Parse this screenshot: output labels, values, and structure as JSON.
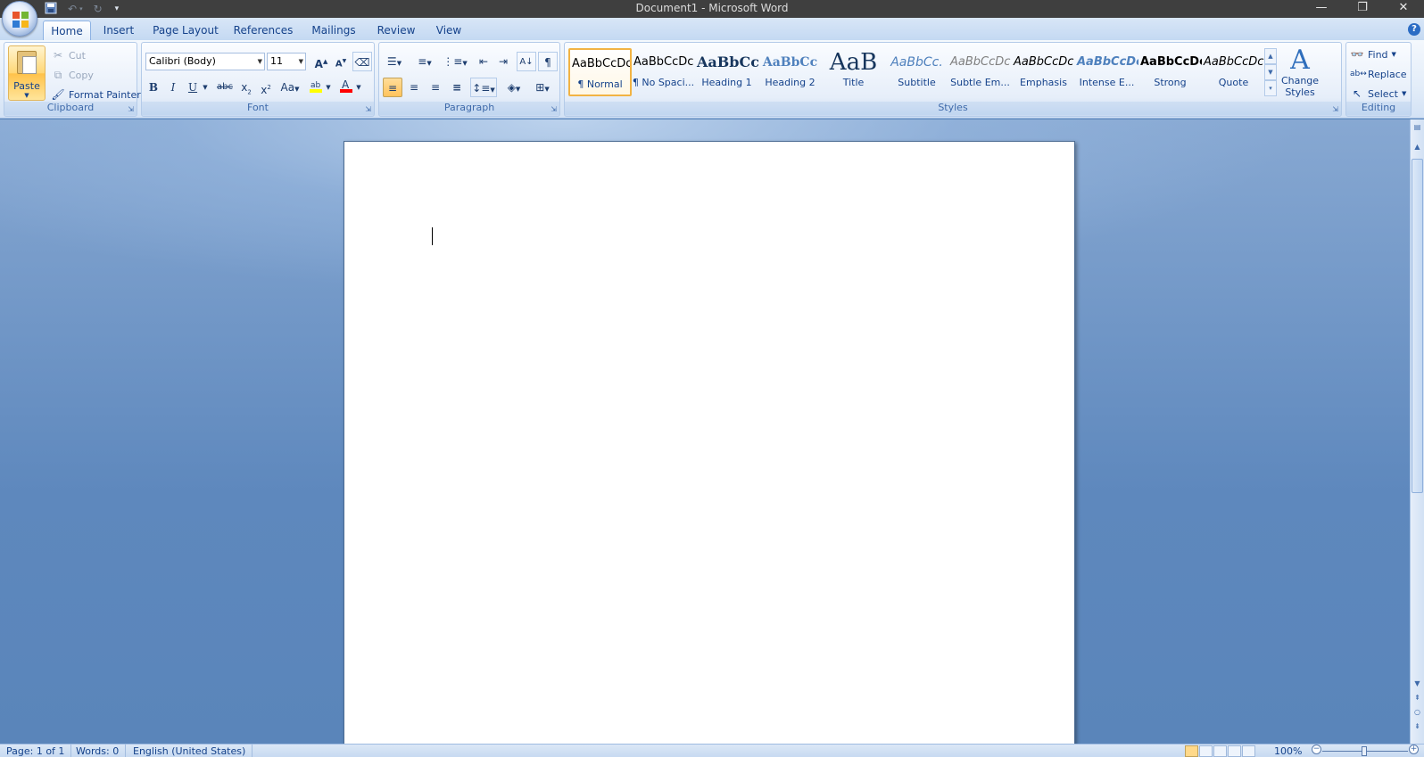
{
  "window": {
    "title": "Document1 - Microsoft Word",
    "controls": {
      "minimize": "—",
      "restore": "❐",
      "close": "✕"
    }
  },
  "qat": {
    "save_icon": "save-icon",
    "undo_icon": "undo-icon",
    "redo_icon": "redo-icon",
    "customize_icon": "chevron-down-icon"
  },
  "tabs": [
    {
      "label": "Home",
      "active": true
    },
    {
      "label": "Insert"
    },
    {
      "label": "Page Layout"
    },
    {
      "label": "References"
    },
    {
      "label": "Mailings"
    },
    {
      "label": "Review"
    },
    {
      "label": "View"
    }
  ],
  "clipboard": {
    "group_label": "Clipboard",
    "paste": "Paste",
    "cut": "Cut",
    "copy": "Copy",
    "format_painter": "Format Painter"
  },
  "font": {
    "group_label": "Font",
    "font_name": "Calibri (Body)",
    "font_size": "11"
  },
  "paragraph": {
    "group_label": "Paragraph"
  },
  "styles": {
    "group_label": "Styles",
    "items": [
      {
        "sample": "AaBbCcDc",
        "name": "¶ Normal"
      },
      {
        "sample": "AaBbCcDc",
        "name": "¶ No Spaci..."
      },
      {
        "sample": "AaBbCc",
        "name": "Heading 1"
      },
      {
        "sample": "AaBbCc",
        "name": "Heading 2"
      },
      {
        "sample": "AaB",
        "name": "Title"
      },
      {
        "sample": "AaBbCc.",
        "name": "Subtitle"
      },
      {
        "sample": "AaBbCcDc",
        "name": "Subtle Em..."
      },
      {
        "sample": "AaBbCcDc",
        "name": "Emphasis"
      },
      {
        "sample": "AaBbCcDc",
        "name": "Intense E..."
      },
      {
        "sample": "AaBbCcDc",
        "name": "Strong"
      },
      {
        "sample": "AaBbCcDc",
        "name": "Quote"
      }
    ],
    "change_styles_line1": "Change",
    "change_styles_line2": "Styles"
  },
  "editing": {
    "group_label": "Editing",
    "find": "Find",
    "replace": "Replace",
    "select": "Select"
  },
  "status": {
    "page": "Page: 1 of 1",
    "words": "Words: 0",
    "language": "English (United States)",
    "zoom": "100%"
  },
  "colors": {
    "ribbon_text": "#15428b",
    "highlight": "#ffff00",
    "font_color": "#ff0000",
    "selected_style_border": "#f2b343"
  }
}
